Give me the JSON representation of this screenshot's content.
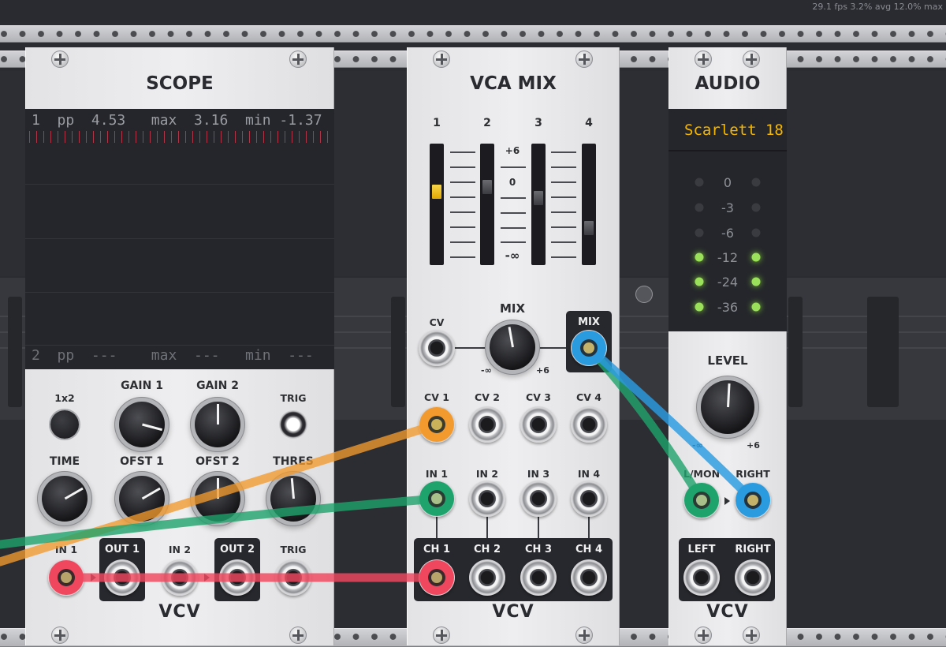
{
  "status_bar": {
    "text": "29.1 fps  3.2% avg  12.0% max"
  },
  "scope": {
    "title": "SCOPE",
    "display": {
      "ch1": {
        "num": "1",
        "pp_label": "pp",
        "pp": "4.53",
        "max_label": "max",
        "max": "3.16",
        "min_label": "min",
        "min": "-1.37"
      },
      "ch2": {
        "num": "2",
        "pp_label": "pp",
        "pp": "---",
        "max_label": "max",
        "max": "---",
        "min_label": "min",
        "min": "---"
      }
    },
    "labels": {
      "x1x2": "1x2",
      "gain1": "GAIN 1",
      "gain2": "GAIN 2",
      "trig_btn": "TRIG",
      "time": "TIME",
      "ofst1": "OFST 1",
      "ofst2": "OFST 2",
      "thres": "THRES",
      "in1": "IN 1",
      "out1": "OUT 1",
      "in2": "IN 2",
      "out2": "OUT 2",
      "trig_in": "TRIG"
    },
    "brand": "VCV"
  },
  "vca_mix": {
    "title": "VCA MIX",
    "channels": [
      "1",
      "2",
      "3",
      "4"
    ],
    "scale": [
      "+6",
      "0",
      "-∞"
    ],
    "fader_levels": [
      0.62,
      0.67,
      0.56,
      0.27
    ],
    "mix_label": "MIX",
    "cv_label": "CV",
    "mix_out_label": "MIX",
    "knob_min": "-∞",
    "knob_max": "+6",
    "cv_labels": [
      "CV 1",
      "CV 2",
      "CV 3",
      "CV 4"
    ],
    "in_labels": [
      "IN 1",
      "IN 2",
      "IN 3",
      "IN 4"
    ],
    "ch_labels": [
      "CH 1",
      "CH 2",
      "CH 3",
      "CH 4"
    ],
    "brand": "VCV"
  },
  "audio": {
    "title": "AUDIO",
    "device": "Scarlett 18",
    "meter_labels": [
      "0",
      "-3",
      "-6",
      "-12",
      "-24",
      "-36"
    ],
    "level_label": "LEVEL",
    "knob_min": "-∞",
    "knob_max": "+6",
    "in_labels": [
      "L/MON",
      "RIGHT"
    ],
    "out_labels": [
      "LEFT",
      "RIGHT"
    ],
    "brand": "VCV"
  },
  "colors": {
    "cable_red": "#f0475e",
    "cable_orange": "#f29a2e",
    "cable_green": "#1fa36c",
    "cable_blue": "#2b9be0",
    "led_on": "#9be05a",
    "led_off": "#3a3b40",
    "meter_text": "#f5b700"
  }
}
